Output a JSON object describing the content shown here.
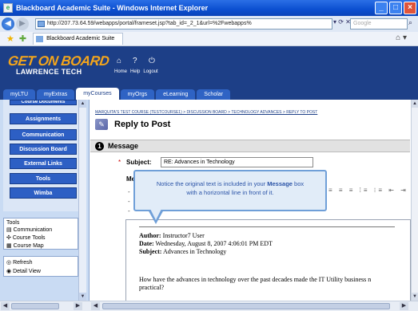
{
  "window": {
    "title": "Blackboard Academic Suite - Windows Internet Explorer",
    "url": "http://207.73.64.59/webapps/portal/frameset.jsp?tab_id=_2_1&url=%2Fwebapps%",
    "search_placeholder": "Google",
    "tab_label": "Blackboard Academic Suite"
  },
  "banner": {
    "logo_line1": "GET ON BOARD",
    "logo_line2": "LAWRENCE TECH",
    "links": [
      "Home",
      "Help",
      "Logout"
    ]
  },
  "nav_tabs": [
    "myLTU",
    "myExtras",
    "myCourses",
    "myOrgs",
    "eLearning",
    "Scholar"
  ],
  "active_tab": "myCourses",
  "sidebar": {
    "partial_item": "Course Documents",
    "items": [
      "Assignments",
      "Communication",
      "Discussion Board",
      "External Links",
      "Tools",
      "Wimba"
    ],
    "tools_heading": "Tools",
    "tools": [
      "Communication",
      "Course Tools",
      "Course Map"
    ],
    "actions": [
      "Refresh",
      "Detail View"
    ]
  },
  "main": {
    "breadcrumb": "MARQUITA'S TEST COURSE (TESTCOURSE1) > DISCUSSION BOARD > TECHNOLOGY ADVANCES > REPLY TO POST",
    "page_title": "Reply to Post",
    "section_number": "1",
    "section_title": "Message",
    "subject_label": "Subject:",
    "subject_value": "RE: Advances in Technology",
    "message_label": "Me",
    "required_mark": "*"
  },
  "callout": {
    "text_before": "Notice the original text is included in your ",
    "text_bold": "Message",
    "text_after": " box",
    "text_line2": "with a horizontal line in front of it."
  },
  "quoted_post": {
    "author_label": "Author:",
    "author": "Instructor7 User",
    "date_label": "Date:",
    "date": "Wednesday, August 8, 2007 4:06:01 PM EDT",
    "subject_label": "Subject:",
    "subject": "Advances in Technology",
    "question": "How have the advances in technology over the past decades made the IT Utility business n",
    "question_line2": "practical?"
  },
  "colors": {
    "banner": "#1d3f87",
    "sidebar_button": "#2d5fc4",
    "logo_orange": "#f3a51c",
    "callout_border": "#6f9fd8"
  }
}
